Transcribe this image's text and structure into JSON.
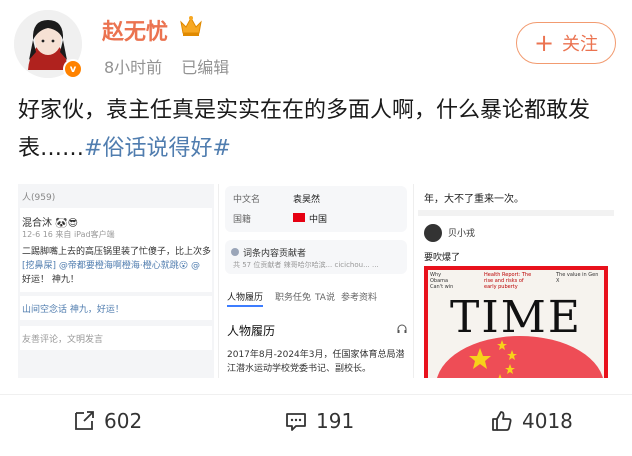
{
  "header": {
    "username": "赵无忧",
    "time": "8小时前",
    "edited": "已编辑",
    "follow_label": "关注",
    "follow_plus": "+",
    "verify_mark": "v"
  },
  "post": {
    "text": "好家伙，袁主任真是实实在在的多面人啊，什么暴论都敢发表……",
    "topic": "#俗话说得好#"
  },
  "images": {
    "img1": {
      "lines": [
        "人(959)",
        "混合沐 🐼😎",
        "12-6 16   来自 iPad客户端",
        "二踢脚嘴上去的高压锅里装了忙傻子，比上次多",
        "[挖鼻屎] @帝都要橙海啊橙海·橙心就跳😮 @",
        "好运！ 神九！",
        "山间空念话  神九，好运！",
        "友善评论，文明发言"
      ]
    },
    "img2": {
      "name_label": "中文名",
      "name_value": "袁昊然",
      "nation_label": "国籍",
      "nation_value": "中国",
      "contributors_label": "词条内容贡献者",
      "contributors_sub": "共 57 位贡献者   辣哥哈尔哈滨...   cicichou...   ...",
      "tabs": [
        "人物履历",
        "职务任免",
        "TA说",
        "参考资料"
      ],
      "section_title": "人物履历",
      "section_text": "2017年8月-2024年3月，任国家体育总局潜江潜水运动学校党委书记、副校长。"
    },
    "img3": {
      "top_text": "年，大不了重来一次。",
      "user_name": "贝小戎",
      "reply_text": "要吹爆了",
      "magazine_title": "TIME",
      "magazine_small": [
        "Why Obama Can't win",
        "Health Report: The rise and risks of early puberty",
        "The value in Gen X"
      ]
    }
  },
  "actions": {
    "repost_count": "602",
    "comment_count": "191",
    "like_count": "4018"
  },
  "colors": {
    "username": "#eb7350",
    "topic": "#507daf",
    "follow_border": "#f29b70",
    "time_red": "#e60012"
  }
}
